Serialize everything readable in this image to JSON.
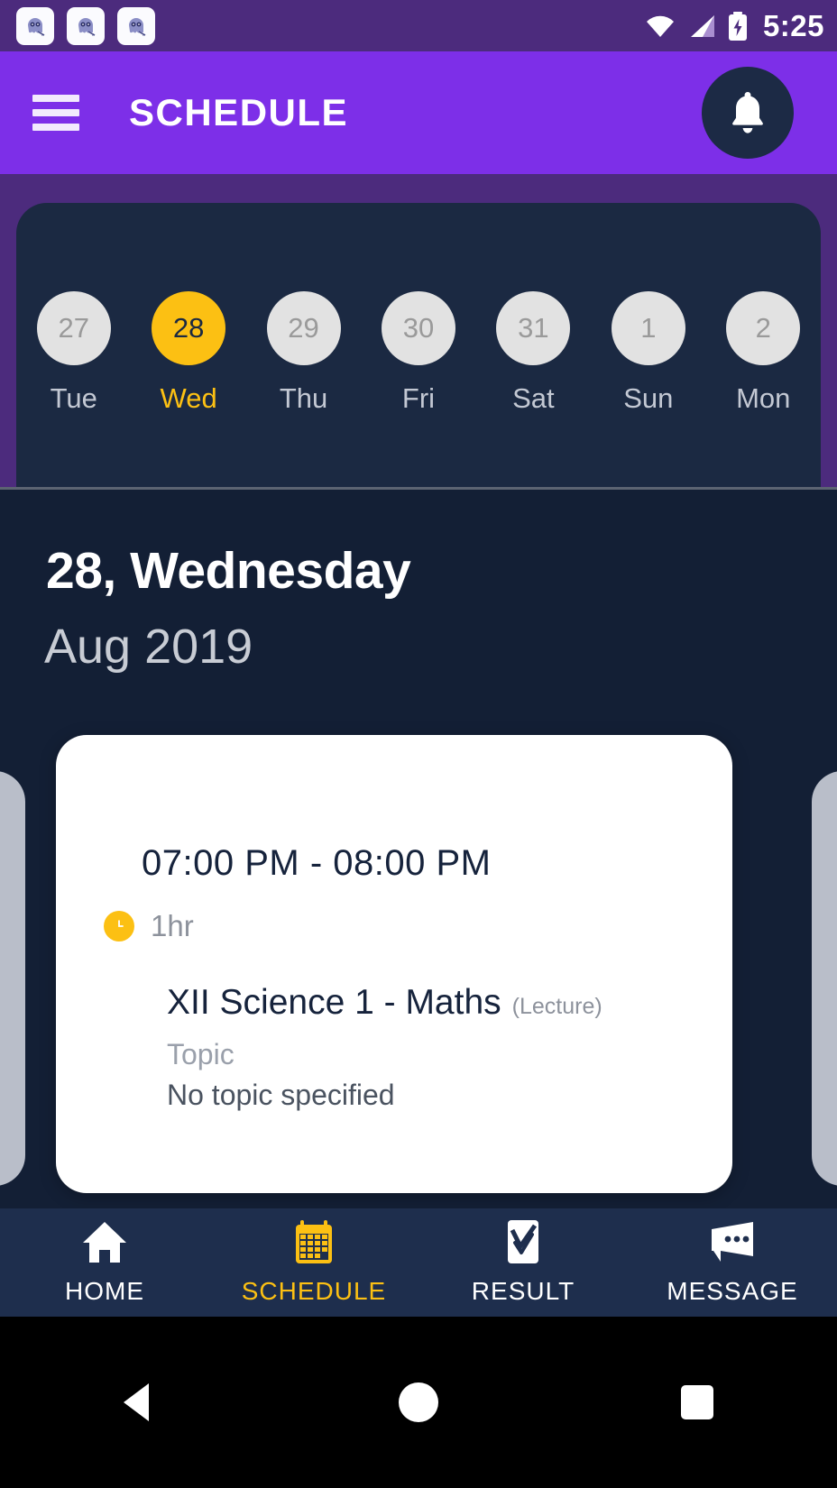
{
  "statusbar": {
    "time": "5:25",
    "notification_icons": [
      "ghost-app-icon",
      "ghost-app-icon",
      "ghost-app-icon"
    ],
    "wifi_icon": "wifi-icon",
    "signal_icon": "signal-bars-icon",
    "battery_icon": "battery-charging-icon",
    "background_color": "#4c2b7d"
  },
  "appbar": {
    "title": "SCHEDULE",
    "menu_icon": "hamburger-menu-icon",
    "notification_icon": "bell-icon",
    "background_color": "#7d2fe8"
  },
  "calendar": {
    "days": [
      {
        "date": "27",
        "weekday": "Tue",
        "selected": false
      },
      {
        "date": "28",
        "weekday": "Wed",
        "selected": true
      },
      {
        "date": "29",
        "weekday": "Thu",
        "selected": false
      },
      {
        "date": "30",
        "weekday": "Fri",
        "selected": false
      },
      {
        "date": "31",
        "weekday": "Sat",
        "selected": false
      },
      {
        "date": "1",
        "weekday": "Sun",
        "selected": false
      },
      {
        "date": "2",
        "weekday": "Mon",
        "selected": false
      }
    ],
    "selected_color": "#fcc013",
    "circle_color": "#e2e2e2",
    "panel_color": "#1b2942"
  },
  "header": {
    "date_title": "28, Wednesday",
    "month_year": "Aug 2019"
  },
  "card": {
    "time_range": "07:00 PM - 08:00 PM",
    "duration": "1hr",
    "duration_icon": "clock-icon",
    "subject": "XII Science 1 - Maths",
    "session_type": "(Lecture)",
    "topic_label": "Topic",
    "topic_value": "No topic specified",
    "background_color": "#ffffff",
    "peek_color": "#b9bec9"
  },
  "bottomnav": {
    "background_color": "#1e2e4d",
    "active_color": "#fcc013",
    "items": [
      {
        "label": "HOME",
        "icon": "home-icon",
        "active": false
      },
      {
        "label": "SCHEDULE",
        "icon": "calendar-icon",
        "active": true
      },
      {
        "label": "RESULT",
        "icon": "result-check-icon",
        "active": false
      },
      {
        "label": "MESSAGE",
        "icon": "message-bubble-icon",
        "active": false
      }
    ]
  },
  "androidnav": {
    "back_icon": "back-triangle-icon",
    "home_icon": "home-circle-icon",
    "recents_icon": "recents-square-icon"
  }
}
